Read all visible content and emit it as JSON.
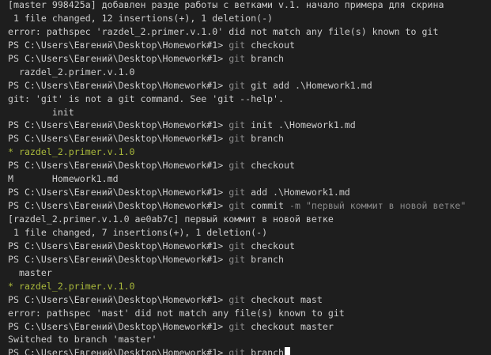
{
  "colors": {
    "background": "#1e1e1e",
    "default": "#cccccc",
    "command": "#8a8a8a",
    "branch": "#a9b83b",
    "string": "#8a8a8a",
    "cursor": "#ffffff"
  },
  "terminal": {
    "lines": [
      {
        "segments": [
          {
            "t": "[master 998425a] добавлен разде работы с ветками v.1. начало примера для скрина"
          }
        ]
      },
      {
        "segments": [
          {
            "t": " 1 file changed, 12 insertions(+), 1 deletion(-)"
          }
        ]
      },
      {
        "segments": [
          {
            "t": "error: pathspec 'razdel_2.primer.v.1.0' did not match any file(s) known to git"
          }
        ]
      },
      {
        "segments": [
          {
            "t": "PS C:\\Users\\Евгений\\Desktop\\Homework#1> "
          },
          {
            "t": "git",
            "c": "command"
          },
          {
            "t": " checkout"
          }
        ]
      },
      {
        "segments": [
          {
            "t": "PS C:\\Users\\Евгений\\Desktop\\Homework#1> "
          },
          {
            "t": "git",
            "c": "command"
          },
          {
            "t": " branch"
          }
        ]
      },
      {
        "segments": [
          {
            "t": "  razdel_2.primer.v.1.0"
          }
        ]
      },
      {
        "segments": [
          {
            "t": "PS C:\\Users\\Евгений\\Desktop\\Homework#1> "
          },
          {
            "t": "git",
            "c": "command"
          },
          {
            "t": " git add .\\Homework1.md"
          }
        ]
      },
      {
        "segments": [
          {
            "t": "git: 'git' is not a git command. See 'git --help'."
          }
        ]
      },
      {
        "segments": [
          {
            "t": "        init"
          }
        ]
      },
      {
        "segments": [
          {
            "t": "PS C:\\Users\\Евгений\\Desktop\\Homework#1> "
          },
          {
            "t": "git",
            "c": "command"
          },
          {
            "t": " init .\\Homework1.md"
          }
        ]
      },
      {
        "segments": [
          {
            "t": "PS C:\\Users\\Евгений\\Desktop\\Homework#1> "
          },
          {
            "t": "git",
            "c": "command"
          },
          {
            "t": " branch"
          }
        ]
      },
      {
        "segments": [
          {
            "t": "* razdel_2.primer.v.1.0",
            "c": "branch"
          }
        ]
      },
      {
        "segments": [
          {
            "t": "PS C:\\Users\\Евгений\\Desktop\\Homework#1> "
          },
          {
            "t": "git",
            "c": "command"
          },
          {
            "t": " checkout"
          }
        ]
      },
      {
        "segments": [
          {
            "t": "M       Homework1.md"
          }
        ]
      },
      {
        "segments": [
          {
            "t": "PS C:\\Users\\Евгений\\Desktop\\Homework#1> "
          },
          {
            "t": "git",
            "c": "command"
          },
          {
            "t": " add .\\Homework1.md"
          }
        ]
      },
      {
        "segments": [
          {
            "t": "PS C:\\Users\\Евгений\\Desktop\\Homework#1> "
          },
          {
            "t": "git",
            "c": "command"
          },
          {
            "t": " commit "
          },
          {
            "t": "-m",
            "c": "command"
          },
          {
            "t": " \"первый коммит в новой ветке\"",
            "c": "string"
          }
        ]
      },
      {
        "segments": [
          {
            "t": "[razdel_2.primer.v.1.0 ae0ab7c] первый коммит в новой ветке"
          }
        ]
      },
      {
        "segments": [
          {
            "t": " 1 file changed, 7 insertions(+), 1 deletion(-)"
          }
        ]
      },
      {
        "segments": [
          {
            "t": "PS C:\\Users\\Евгений\\Desktop\\Homework#1> "
          },
          {
            "t": "git",
            "c": "command"
          },
          {
            "t": " checkout"
          }
        ]
      },
      {
        "segments": [
          {
            "t": "PS C:\\Users\\Евгений\\Desktop\\Homework#1> "
          },
          {
            "t": "git",
            "c": "command"
          },
          {
            "t": " branch"
          }
        ]
      },
      {
        "segments": [
          {
            "t": "  master"
          }
        ]
      },
      {
        "segments": [
          {
            "t": "* razdel_2.primer.v.1.0",
            "c": "branch"
          }
        ]
      },
      {
        "segments": [
          {
            "t": "PS C:\\Users\\Евгений\\Desktop\\Homework#1> "
          },
          {
            "t": "git",
            "c": "command"
          },
          {
            "t": " checkout mast"
          }
        ]
      },
      {
        "segments": [
          {
            "t": "error: pathspec 'mast' did not match any file(s) known to git"
          }
        ]
      },
      {
        "segments": [
          {
            "t": "PS C:\\Users\\Евгений\\Desktop\\Homework#1> "
          },
          {
            "t": "git",
            "c": "command"
          },
          {
            "t": " checkout master"
          }
        ]
      },
      {
        "segments": [
          {
            "t": "Switched to branch 'master'"
          }
        ]
      },
      {
        "segments": [
          {
            "t": "PS C:\\Users\\Евгений\\Desktop\\Homework#1> "
          },
          {
            "t": "git",
            "c": "command"
          },
          {
            "t": " branch"
          }
        ],
        "cursor": true
      }
    ]
  }
}
